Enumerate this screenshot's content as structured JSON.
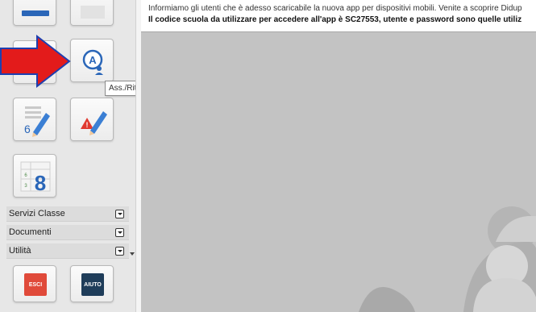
{
  "notice": {
    "line1": "Informiamo gli utenti che è adesso scaricabile la nuova app per dispositivi mobili. Venite a scoprire Didup",
    "line2": "Il codice scuola da utilizzare per accedere all'app è SC27553, utente e password sono quelle utiliz"
  },
  "tooltip": {
    "text": "Ass./Rit./Uscite"
  },
  "tiles": [
    {
      "name": "tile-top-left",
      "icon": "blue-book-icon"
    },
    {
      "name": "tile-top-right",
      "icon": "blank-icon"
    },
    {
      "name": "tile-registro",
      "icon": "green-register-icon"
    },
    {
      "name": "tile-assenze",
      "icon": "absence-user-icon"
    },
    {
      "name": "tile-voti",
      "icon": "grade-pencil-icon"
    },
    {
      "name": "tile-note",
      "icon": "warning-pencil-icon"
    },
    {
      "name": "tile-calendar",
      "icon": "calendar-8-icon"
    }
  ],
  "calendar": {
    "digit": "8",
    "small1": "6",
    "small2": "3"
  },
  "grade_digit": "6",
  "sections": [
    {
      "label": "Servizi Classe"
    },
    {
      "label": "Documenti"
    },
    {
      "label": "Utilità"
    }
  ],
  "buttons": {
    "exit_label": "ESCI",
    "help_label": "AIUTO"
  },
  "colors": {
    "sidebar_bg": "#e7e7e7",
    "main_bg": "#c3c3c3",
    "arrow_red": "#e31b1b",
    "arrow_blue": "#1d3fb0",
    "exit_red": "#e04a3a",
    "help_navy": "#1f3d5a",
    "accent_blue": "#2a66b8"
  }
}
